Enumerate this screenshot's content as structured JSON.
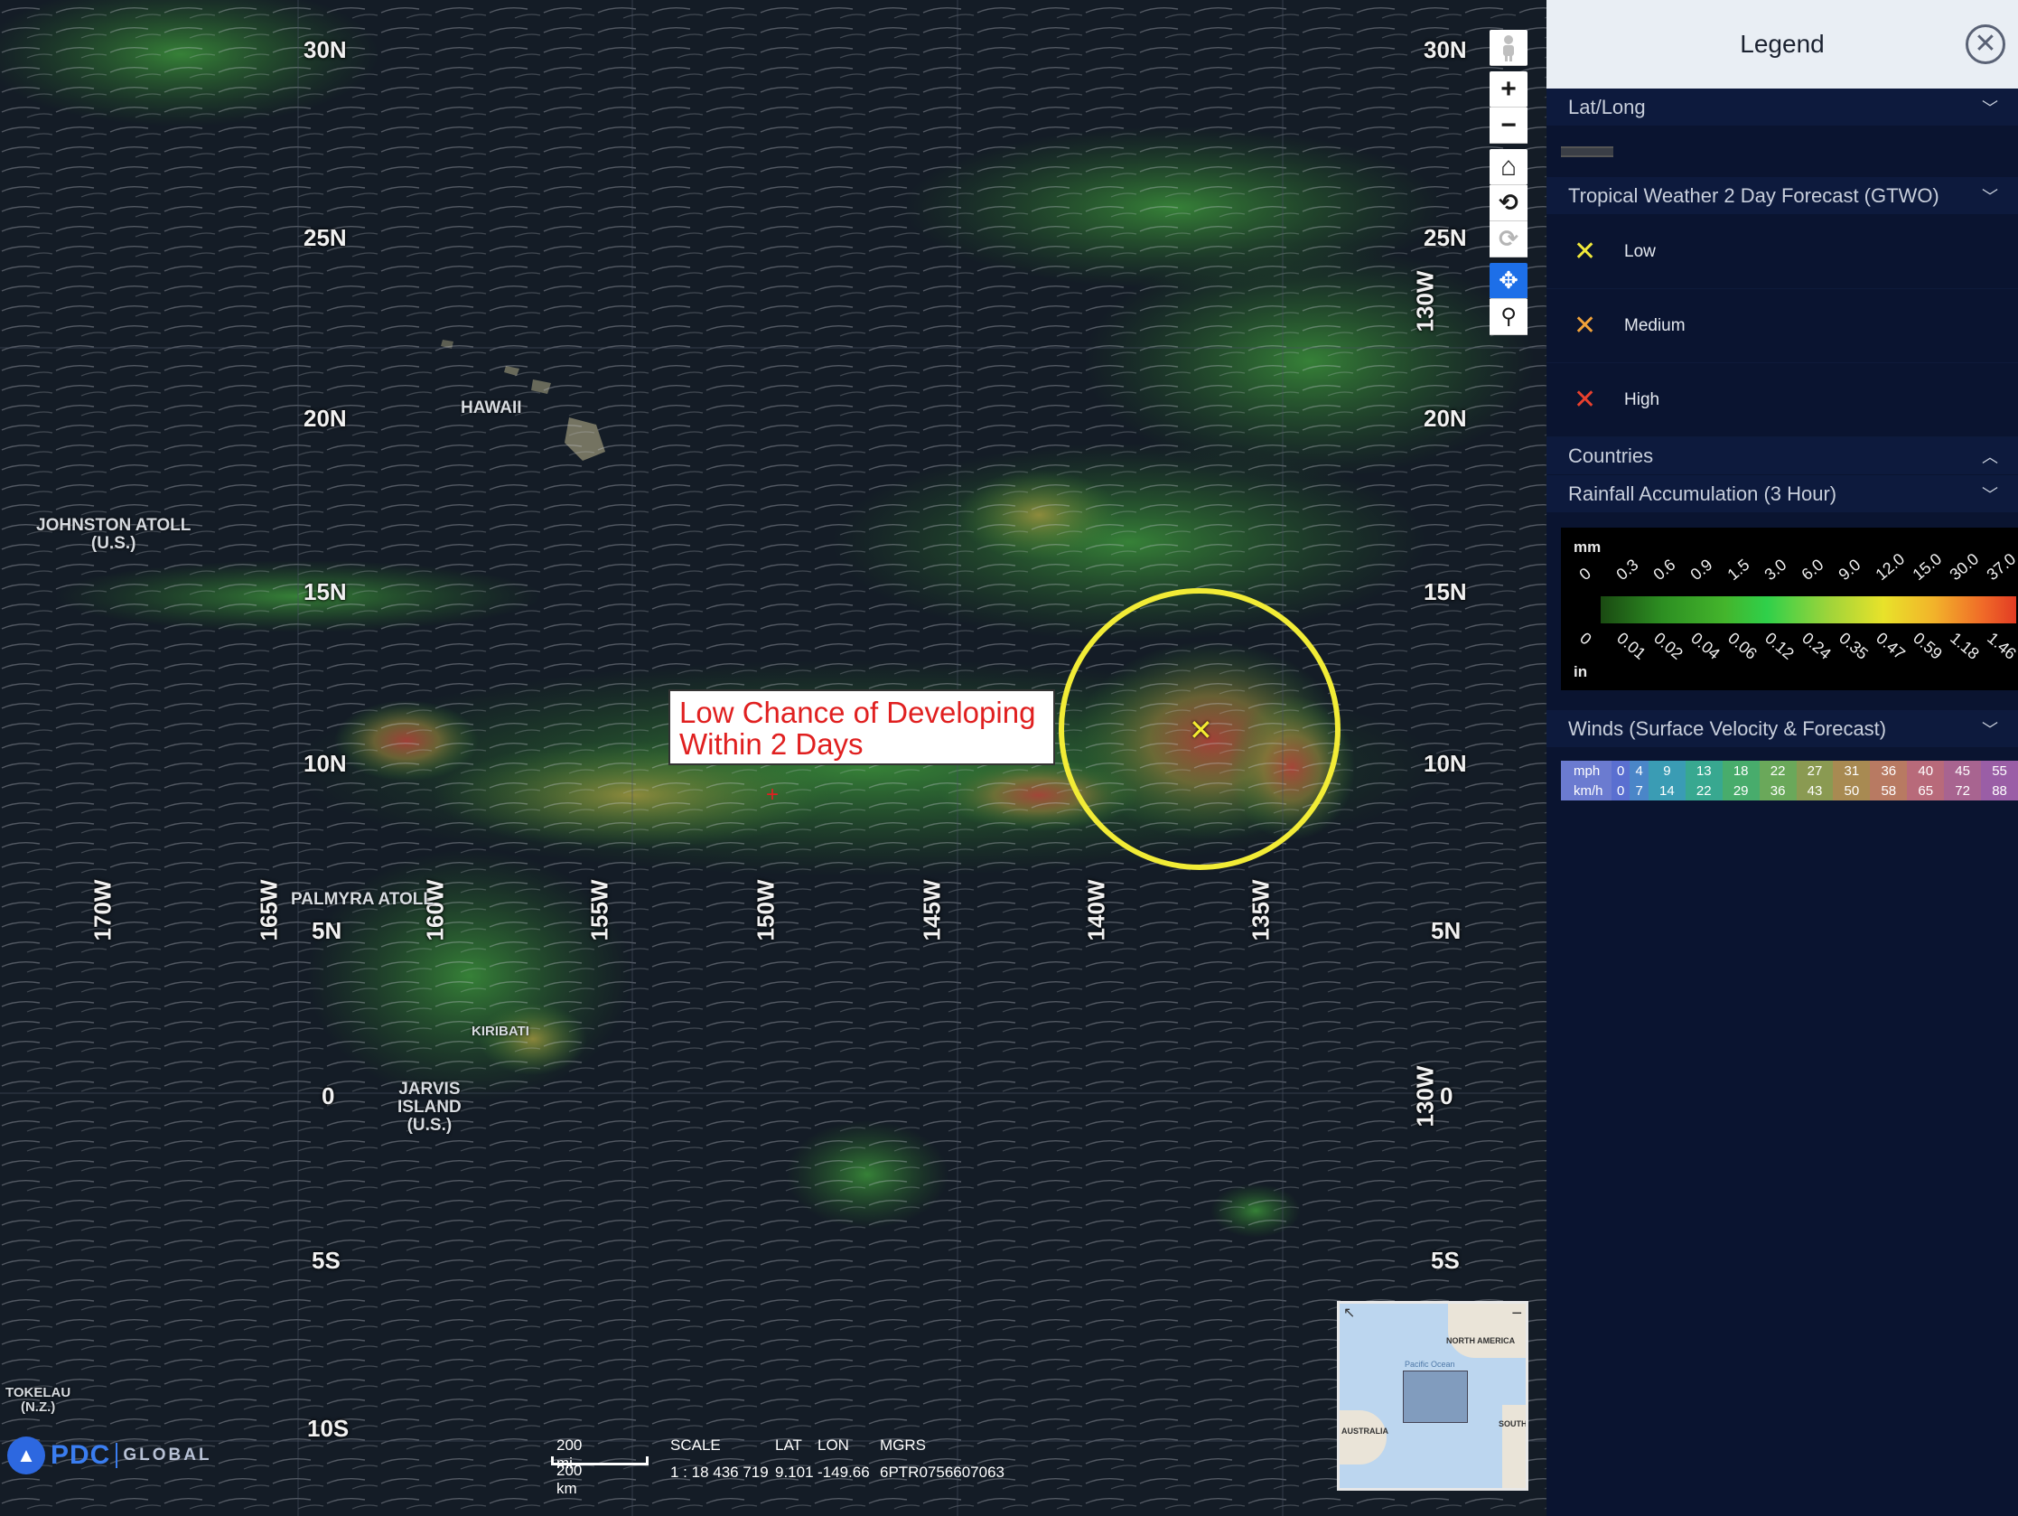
{
  "map": {
    "lat_labels": [
      "30N",
      "25N",
      "20N",
      "15N",
      "10N",
      "5N",
      "0",
      "5S",
      "10S"
    ],
    "lon_labels": [
      "170W",
      "165W",
      "160W",
      "155W",
      "150W",
      "145W",
      "140W",
      "135W",
      "130W"
    ],
    "places": [
      "HAWAII",
      "JOHNSTON ATOLL\n(U.S.)",
      "PALMYRA ATOLL",
      "KIRIBATI",
      "JARVIS\nISLAND\n(U.S.)",
      "TOKELAU\n(N.Z.)"
    ],
    "annotation": "Low Chance of Developing Within 2 Days",
    "storm_marker": "✕",
    "cursor": "+",
    "colors": {
      "circle": "#f2ec36",
      "annotation_text": "#e02020"
    }
  },
  "controls": {
    "streetview_icon": "person-icon",
    "zoom_in": "+",
    "zoom_out": "−",
    "home": "⌂",
    "rotate_ccw": "⟲",
    "rotate_cw": "⟳",
    "pan": "✥",
    "zoom_box": "⚲"
  },
  "scale": {
    "mi": "200 mi",
    "km": "200 km",
    "headers": {
      "scale": "SCALE",
      "lat": "LAT",
      "lon": "LON",
      "mgrs": "MGRS"
    },
    "values": {
      "scale": "1 : 18 436 719",
      "lat": "9.101",
      "lon": "-149.66",
      "mgrs": "6PTR0756607063"
    }
  },
  "logo": {
    "mark": "▲",
    "pdc": "PDC",
    "global": "GLOBAL"
  },
  "overview": {
    "labels": {
      "north_america": "NORTH AMERICA",
      "australia": "AUSTRALIA",
      "south": "SOUTH",
      "ocean": "Pacific Ocean"
    },
    "collapse": "−",
    "expand": "↖"
  },
  "legend": {
    "title": "Legend",
    "close": "✕",
    "sections": {
      "latlong": "Lat/Long",
      "gtwo": "Tropical Weather 2 Day Forecast (GTWO)",
      "countries": "Countries",
      "rainfall": "Rainfall Accumulation (3 Hour)",
      "winds": "Winds (Surface Velocity & Forecast)"
    },
    "chevron_down": "﹀",
    "chevron_up": "︿",
    "gtwo_items": [
      {
        "label": "Low",
        "mark": "✕",
        "color": "#f1e93a"
      },
      {
        "label": "Medium",
        "mark": "✕",
        "color": "#f0a23a"
      },
      {
        "label": "High",
        "mark": "✕",
        "color": "#e8402e"
      }
    ],
    "rainfall": {
      "unit_mm": "mm",
      "unit_in": "in",
      "mm_ticks": [
        "0",
        "0.3",
        "0.6",
        "0.9",
        "1.5",
        "3.0",
        "6.0",
        "9.0",
        "12.0",
        "15.0",
        "30.0",
        "37.0"
      ],
      "in_ticks": [
        "0",
        "0.01",
        "0.02",
        "0.04",
        "0.06",
        "0.12",
        "0.24",
        "0.35",
        "0.47",
        "0.59",
        "1.18",
        "1.46"
      ]
    },
    "winds": {
      "mph_label": "mph",
      "kmh_label": "km/h",
      "mph": [
        "0",
        "4",
        "9",
        "13",
        "18",
        "22",
        "27",
        "31",
        "36",
        "40",
        "45",
        "55"
      ],
      "kmh": [
        "0",
        "7",
        "14",
        "22",
        "29",
        "36",
        "43",
        "50",
        "58",
        "65",
        "72",
        "88"
      ],
      "colors": [
        "#5a6fd0",
        "#4a86c8",
        "#3a9cb4",
        "#38a890",
        "#48ac6c",
        "#6aa85a",
        "#8a9a52",
        "#a88a52",
        "#b87a62",
        "#b86a7a",
        "#a86490",
        "#9a5ea6"
      ]
    }
  }
}
